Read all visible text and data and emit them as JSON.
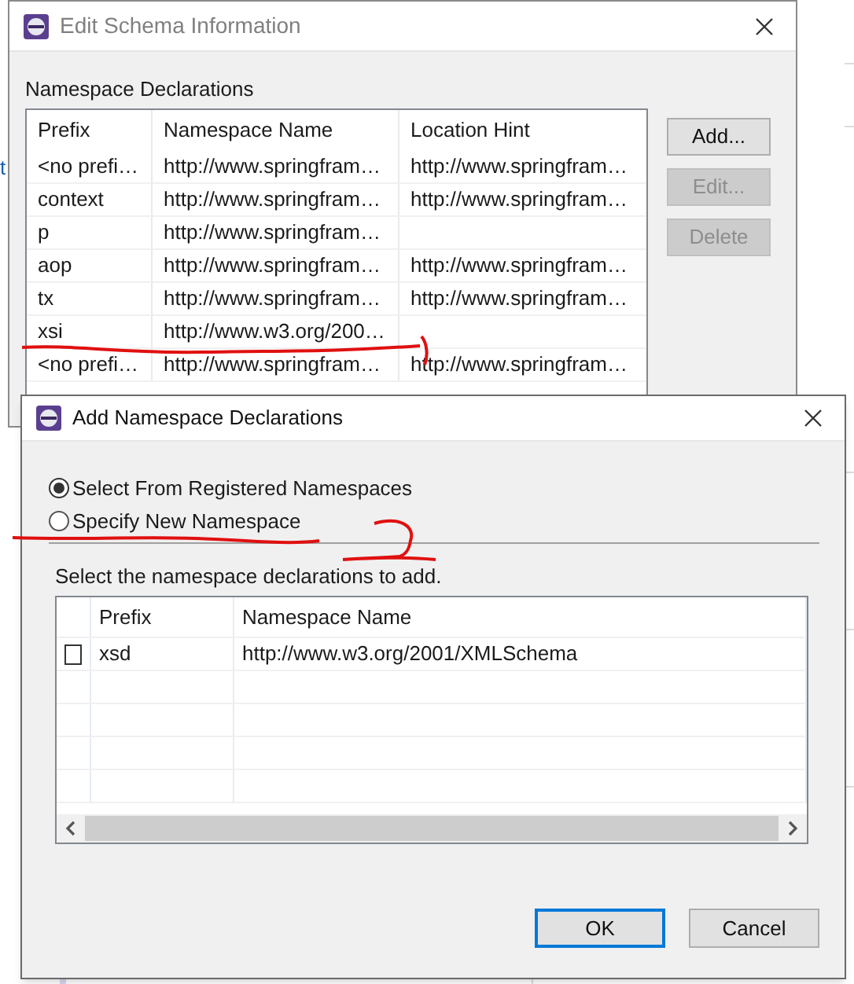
{
  "background_fragment": "t",
  "schema_dialog": {
    "title": "Edit Schema Information",
    "section_label": "Namespace Declarations",
    "columns": [
      "Prefix",
      "Namespace Name",
      "Location Hint"
    ],
    "rows": [
      [
        "<no prefi…",
        "http://www.springfram…",
        "http://www.springfram…"
      ],
      [
        "context",
        "http://www.springfram…",
        "http://www.springfram…"
      ],
      [
        "p",
        "http://www.springfram…",
        ""
      ],
      [
        "aop",
        "http://www.springfram…",
        "http://www.springfram…"
      ],
      [
        "tx",
        "http://www.springfram…",
        "http://www.springfram…"
      ],
      [
        "xsi",
        "http://www.w3.org/200…",
        ""
      ],
      [
        "<no prefi…",
        "http://www.springfram…",
        "http://www.springfram…"
      ]
    ],
    "buttons": [
      {
        "label": "Add...",
        "disabled": false
      },
      {
        "label": "Edit...",
        "disabled": true
      },
      {
        "label": "Delete",
        "disabled": true
      }
    ]
  },
  "add_dialog": {
    "title": "Add Namespace Declarations",
    "options": [
      {
        "label": "Select From Registered Namespaces",
        "selected": true
      },
      {
        "label": "Specify New Namespace",
        "selected": false
      }
    ],
    "instruction": "Select the namespace declarations to add.",
    "columns": [
      "Prefix",
      "Namespace Name"
    ],
    "rows": [
      {
        "prefix": "xsd",
        "namespace": "http://www.w3.org/2001/XMLSchema",
        "checked": false
      }
    ],
    "buttons": [
      {
        "label": "OK",
        "default": true
      },
      {
        "label": "Cancel",
        "default": false
      }
    ]
  }
}
